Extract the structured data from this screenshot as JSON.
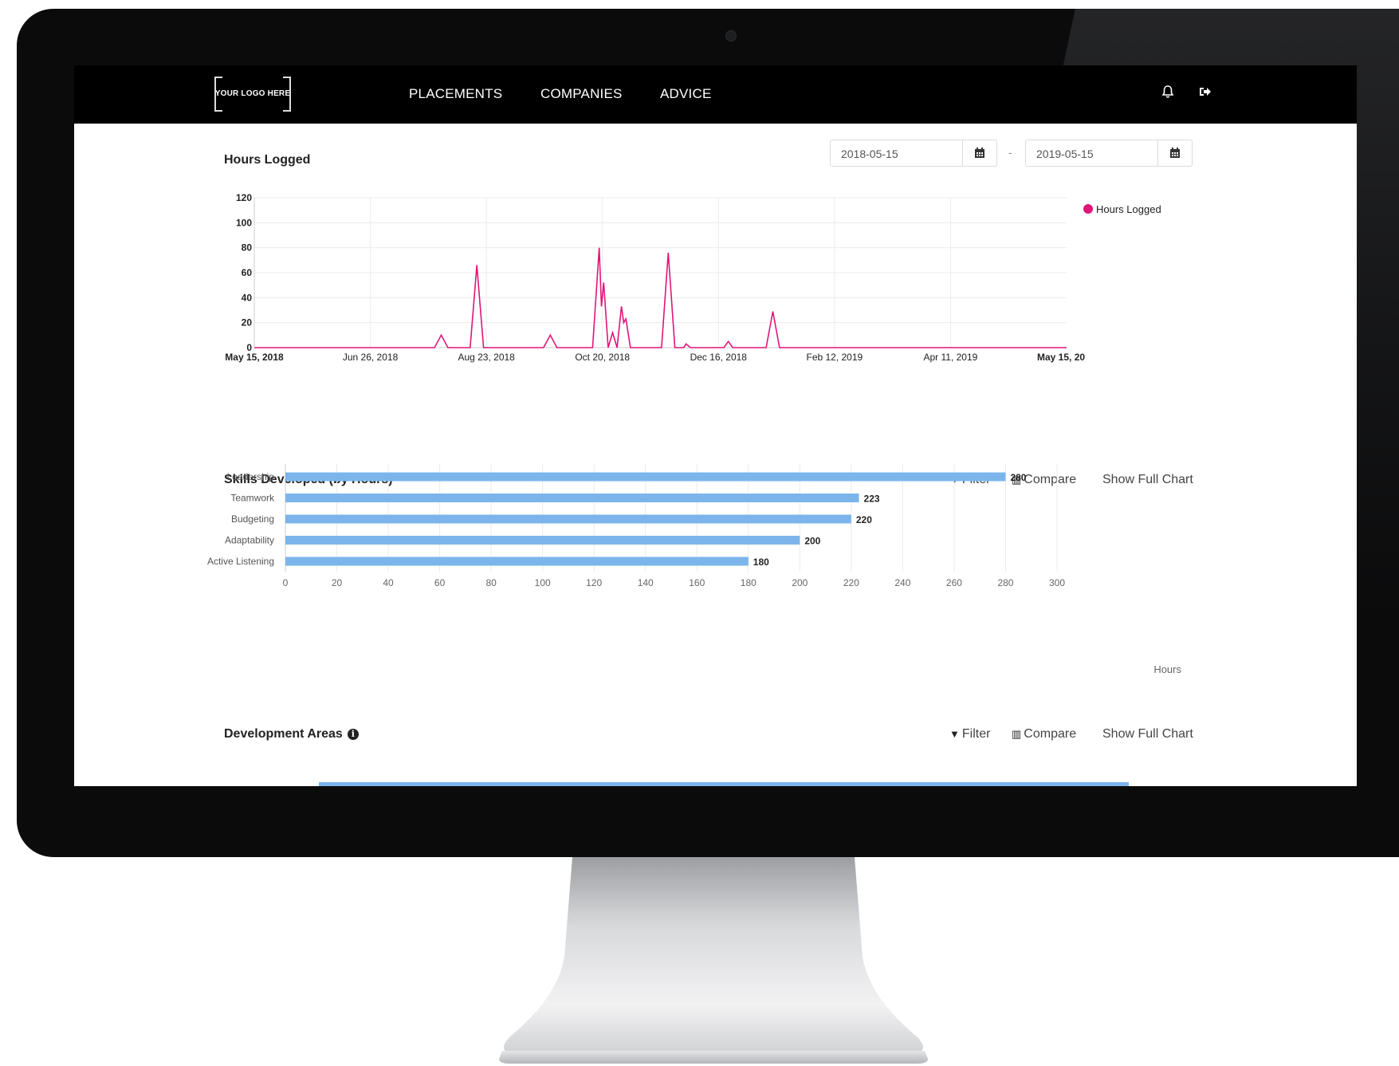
{
  "nav": {
    "logo": "YOUR LOGO HERE",
    "links": [
      "PLACEMENTS",
      "COMPANIES",
      "ADVICE"
    ],
    "bell_icon": "bell-icon",
    "signout_icon": "sign-out-icon"
  },
  "hours": {
    "title": "Hours Logged",
    "date_from": "2018-05-15",
    "date_to": "2019-05-15",
    "date_separator": "-",
    "legend": "Hours Logged"
  },
  "skills": {
    "title": "Skills Developed (by Hours)",
    "filter_label": "Filter",
    "compare_label": "Compare",
    "full_chart_label": "Show Full Chart"
  },
  "dev": {
    "title": "Development Areas",
    "filter_label": "Filter",
    "compare_label": "Compare",
    "full_chart_label": "Show Full Chart"
  },
  "colors": {
    "line": "#e0157a",
    "bar": "#7cb5ec",
    "nav_bg": "#000000"
  },
  "chart_data": [
    {
      "type": "line",
      "title": "",
      "xlabel": "",
      "ylabel": "",
      "legend": "top-right",
      "series": [
        {
          "name": "Hours Logged",
          "points": [
            [
              "2018-05-15",
              0
            ],
            [
              "2018-08-04",
              0
            ],
            [
              "2018-08-07",
              10
            ],
            [
              "2018-08-10",
              0
            ],
            [
              "2018-08-20",
              0
            ],
            [
              "2018-08-23",
              66
            ],
            [
              "2018-08-26",
              0
            ],
            [
              "2018-09-22",
              0
            ],
            [
              "2018-09-25",
              10
            ],
            [
              "2018-09-28",
              0
            ],
            [
              "2018-10-14",
              0
            ],
            [
              "2018-10-17",
              80
            ],
            [
              "2018-10-18",
              33
            ],
            [
              "2018-10-19",
              52
            ],
            [
              "2018-10-21",
              0
            ],
            [
              "2018-10-23",
              12
            ],
            [
              "2018-10-25",
              0
            ],
            [
              "2018-10-27",
              33
            ],
            [
              "2018-10-28",
              20
            ],
            [
              "2018-10-29",
              23
            ],
            [
              "2018-10-31",
              0
            ],
            [
              "2018-11-14",
              0
            ],
            [
              "2018-11-17",
              76
            ],
            [
              "2018-11-20",
              0
            ],
            [
              "2018-11-24",
              0
            ],
            [
              "2018-11-25",
              3
            ],
            [
              "2018-11-27",
              0
            ],
            [
              "2018-12-12",
              0
            ],
            [
              "2018-12-14",
              5
            ],
            [
              "2018-12-16",
              0
            ],
            [
              "2018-12-31",
              0
            ],
            [
              "2019-01-03",
              29
            ],
            [
              "2019-01-06",
              0
            ],
            [
              "2019-05-15",
              0
            ]
          ]
        }
      ],
      "x_ticks": [
        "May 15, 2018",
        "Jun 26, 2018",
        "Aug 23, 2018",
        "Oct 20, 2018",
        "Dec 16, 2018",
        "Feb 12, 2019",
        "Apr 11, 2019",
        "May 15, 20"
      ],
      "y_ticks": [
        0,
        20,
        40,
        60,
        80,
        100,
        120
      ],
      "ylim": [
        0,
        120
      ],
      "xlim": [
        "2018-05-15",
        "2019-05-15"
      ]
    },
    {
      "type": "bar",
      "orientation": "horizontal",
      "categories": [
        "Leadership",
        "Teamwork",
        "Budgeting",
        "Adaptability",
        "Active Listening"
      ],
      "values": [
        280,
        223,
        220,
        200,
        180
      ],
      "xlabel": "Hours",
      "x_ticks": [
        0,
        20,
        40,
        60,
        80,
        100,
        120,
        140,
        160,
        180,
        200,
        220,
        240,
        260,
        280,
        300
      ],
      "xlim": [
        0,
        300
      ]
    }
  ]
}
